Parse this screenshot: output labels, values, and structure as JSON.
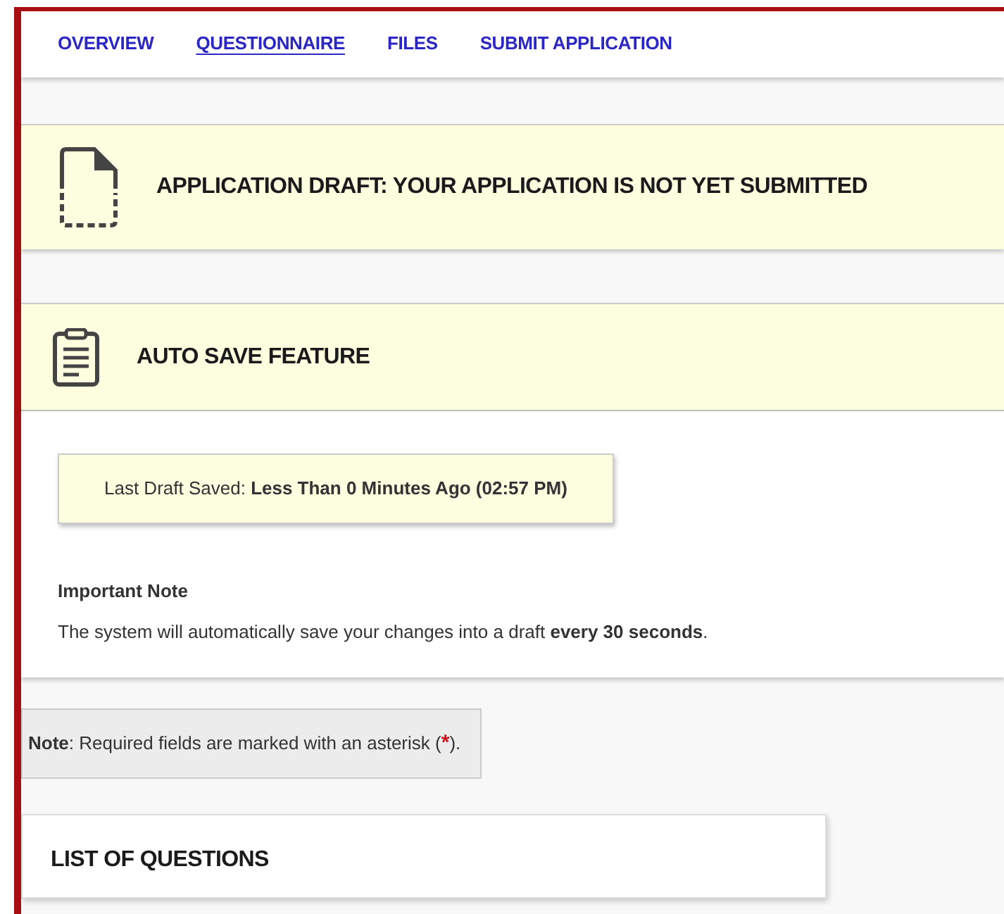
{
  "nav": {
    "tabs": [
      {
        "label": "OVERVIEW",
        "selected": false
      },
      {
        "label": "QUESTIONNAIRE",
        "selected": true
      },
      {
        "label": "FILES",
        "selected": false
      },
      {
        "label": "SUBMIT APPLICATION",
        "selected": false
      }
    ]
  },
  "draft_banner": {
    "title": "APPLICATION DRAFT: YOUR APPLICATION IS NOT YET SUBMITTED"
  },
  "auto_save": {
    "title": "AUTO SAVE FEATURE",
    "last_saved": "Last Draft Saved: **Less Than 0 Minutes Ago (02:57 PM)**",
    "note_heading": "Important Note",
    "note_text": "The system will automatically save your changes into a draft **every 30 seconds**."
  },
  "required_note": {
    "text_before": "**Note**: Required fields are marked with an asterisk (",
    "asterisk": "*",
    "text_after": ")."
  },
  "questions": {
    "title": "LIST OF QUESTIONS"
  }
}
